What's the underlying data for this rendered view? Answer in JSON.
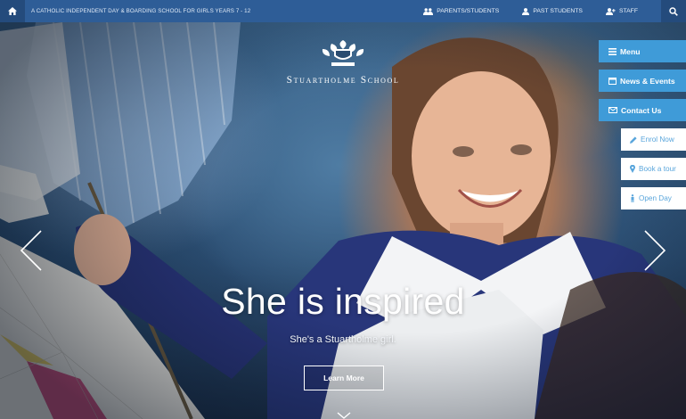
{
  "topbar": {
    "tagline": "A Catholic Independent Day & Boarding School for Girls Years 7 - 12",
    "links": [
      {
        "label": "PARENTS/STUDENTS",
        "icon": "users-icon"
      },
      {
        "label": "PAST STUDENTS",
        "icon": "user-icon"
      },
      {
        "label": "STAFF",
        "icon": "user-plus-icon"
      }
    ],
    "home_icon": "home-icon",
    "search_icon": "search-icon"
  },
  "logo": {
    "name": "Stuartholme School"
  },
  "side_menu": {
    "primary": [
      {
        "label": "Menu",
        "icon": "hamburger-icon"
      },
      {
        "label": "News & Events",
        "icon": "calendar-icon"
      },
      {
        "label": "Contact Us",
        "icon": "envelope-icon"
      }
    ],
    "secondary": [
      {
        "label": "Enrol Now",
        "icon": "pencil-icon"
      },
      {
        "label": "Book a tour",
        "icon": "map-marker-icon"
      },
      {
        "label": "Open Day",
        "icon": "person-icon"
      }
    ]
  },
  "hero": {
    "headline": "She is inspired",
    "subheadline": "She's a Stuartholme girl.",
    "cta": "Learn More"
  },
  "colors": {
    "topbar": "#2e5d97",
    "side_primary": "#3f9bd8",
    "side_secondary_text": "#5aa6dc"
  }
}
